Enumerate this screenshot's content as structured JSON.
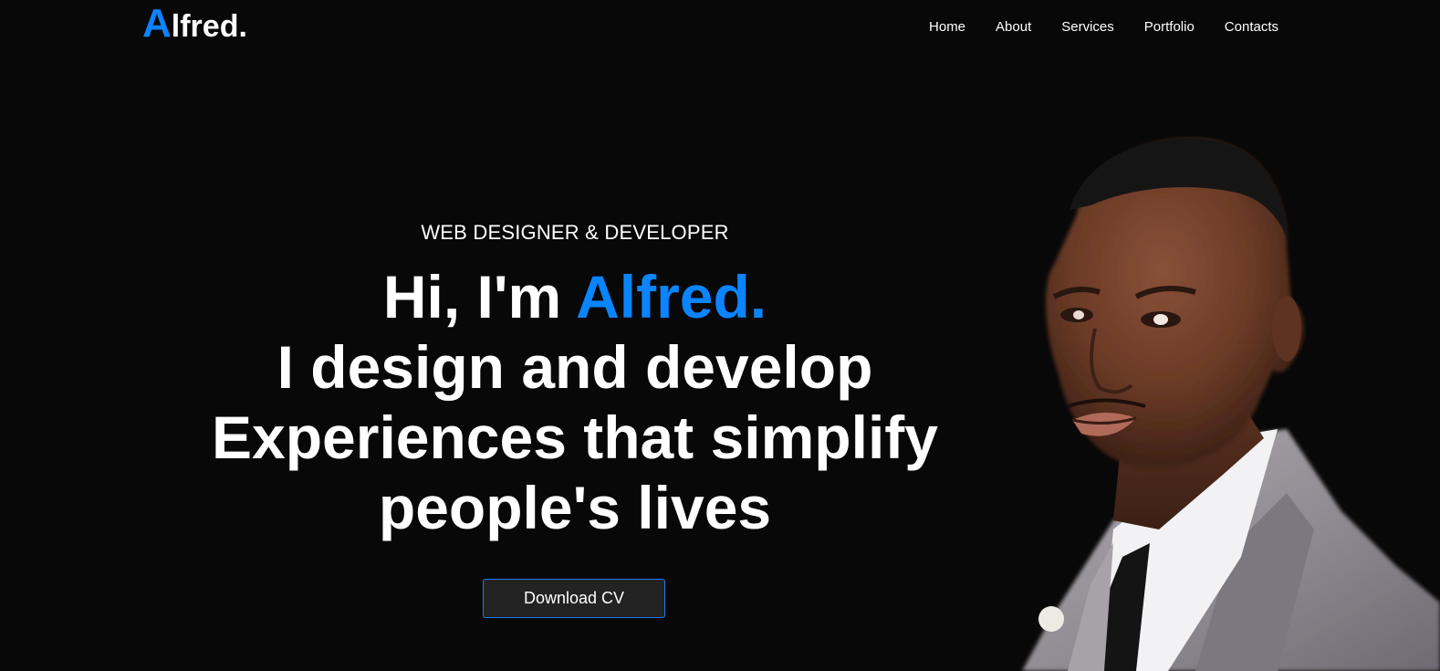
{
  "header": {
    "logo_initial": "A",
    "logo_rest": "lfred.",
    "nav": [
      "Home",
      "About",
      "Services",
      "Portfolio",
      "Contacts"
    ]
  },
  "hero": {
    "subtitle": "WEB DESIGNER & DEVELOPER",
    "greeting": "Hi, I'm ",
    "name": "Alfred.",
    "line2": "I design and develop",
    "line3": "Experiences that simplify",
    "line4": "people's lives",
    "cta_label": "Download CV"
  },
  "colors": {
    "background": "#080808",
    "accent": "#0a84ff",
    "button_bg": "#232323",
    "text": "#ffffff"
  },
  "portrait": {
    "icon": "person-portrait-photo"
  }
}
